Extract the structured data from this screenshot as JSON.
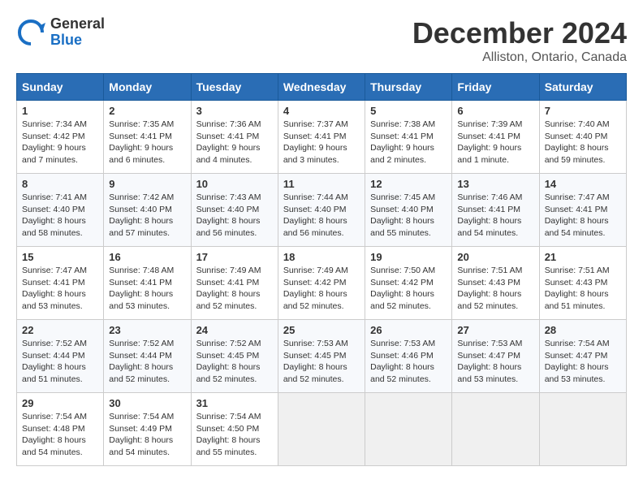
{
  "header": {
    "logo_general": "General",
    "logo_blue": "Blue",
    "month_title": "December 2024",
    "location": "Alliston, Ontario, Canada"
  },
  "days_of_week": [
    "Sunday",
    "Monday",
    "Tuesday",
    "Wednesday",
    "Thursday",
    "Friday",
    "Saturday"
  ],
  "weeks": [
    [
      {
        "day": "1",
        "sunrise": "7:34 AM",
        "sunset": "4:42 PM",
        "daylight": "9 hours and 7 minutes."
      },
      {
        "day": "2",
        "sunrise": "7:35 AM",
        "sunset": "4:41 PM",
        "daylight": "9 hours and 6 minutes."
      },
      {
        "day": "3",
        "sunrise": "7:36 AM",
        "sunset": "4:41 PM",
        "daylight": "9 hours and 4 minutes."
      },
      {
        "day": "4",
        "sunrise": "7:37 AM",
        "sunset": "4:41 PM",
        "daylight": "9 hours and 3 minutes."
      },
      {
        "day": "5",
        "sunrise": "7:38 AM",
        "sunset": "4:41 PM",
        "daylight": "9 hours and 2 minutes."
      },
      {
        "day": "6",
        "sunrise": "7:39 AM",
        "sunset": "4:41 PM",
        "daylight": "9 hours and 1 minute."
      },
      {
        "day": "7",
        "sunrise": "7:40 AM",
        "sunset": "4:40 PM",
        "daylight": "8 hours and 59 minutes."
      }
    ],
    [
      {
        "day": "8",
        "sunrise": "7:41 AM",
        "sunset": "4:40 PM",
        "daylight": "8 hours and 58 minutes."
      },
      {
        "day": "9",
        "sunrise": "7:42 AM",
        "sunset": "4:40 PM",
        "daylight": "8 hours and 57 minutes."
      },
      {
        "day": "10",
        "sunrise": "7:43 AM",
        "sunset": "4:40 PM",
        "daylight": "8 hours and 56 minutes."
      },
      {
        "day": "11",
        "sunrise": "7:44 AM",
        "sunset": "4:40 PM",
        "daylight": "8 hours and 56 minutes."
      },
      {
        "day": "12",
        "sunrise": "7:45 AM",
        "sunset": "4:40 PM",
        "daylight": "8 hours and 55 minutes."
      },
      {
        "day": "13",
        "sunrise": "7:46 AM",
        "sunset": "4:41 PM",
        "daylight": "8 hours and 54 minutes."
      },
      {
        "day": "14",
        "sunrise": "7:47 AM",
        "sunset": "4:41 PM",
        "daylight": "8 hours and 54 minutes."
      }
    ],
    [
      {
        "day": "15",
        "sunrise": "7:47 AM",
        "sunset": "4:41 PM",
        "daylight": "8 hours and 53 minutes."
      },
      {
        "day": "16",
        "sunrise": "7:48 AM",
        "sunset": "4:41 PM",
        "daylight": "8 hours and 53 minutes."
      },
      {
        "day": "17",
        "sunrise": "7:49 AM",
        "sunset": "4:41 PM",
        "daylight": "8 hours and 52 minutes."
      },
      {
        "day": "18",
        "sunrise": "7:49 AM",
        "sunset": "4:42 PM",
        "daylight": "8 hours and 52 minutes."
      },
      {
        "day": "19",
        "sunrise": "7:50 AM",
        "sunset": "4:42 PM",
        "daylight": "8 hours and 52 minutes."
      },
      {
        "day": "20",
        "sunrise": "7:51 AM",
        "sunset": "4:43 PM",
        "daylight": "8 hours and 52 minutes."
      },
      {
        "day": "21",
        "sunrise": "7:51 AM",
        "sunset": "4:43 PM",
        "daylight": "8 hours and 51 minutes."
      }
    ],
    [
      {
        "day": "22",
        "sunrise": "7:52 AM",
        "sunset": "4:44 PM",
        "daylight": "8 hours and 51 minutes."
      },
      {
        "day": "23",
        "sunrise": "7:52 AM",
        "sunset": "4:44 PM",
        "daylight": "8 hours and 52 minutes."
      },
      {
        "day": "24",
        "sunrise": "7:52 AM",
        "sunset": "4:45 PM",
        "daylight": "8 hours and 52 minutes."
      },
      {
        "day": "25",
        "sunrise": "7:53 AM",
        "sunset": "4:45 PM",
        "daylight": "8 hours and 52 minutes."
      },
      {
        "day": "26",
        "sunrise": "7:53 AM",
        "sunset": "4:46 PM",
        "daylight": "8 hours and 52 minutes."
      },
      {
        "day": "27",
        "sunrise": "7:53 AM",
        "sunset": "4:47 PM",
        "daylight": "8 hours and 53 minutes."
      },
      {
        "day": "28",
        "sunrise": "7:54 AM",
        "sunset": "4:47 PM",
        "daylight": "8 hours and 53 minutes."
      }
    ],
    [
      {
        "day": "29",
        "sunrise": "7:54 AM",
        "sunset": "4:48 PM",
        "daylight": "8 hours and 54 minutes."
      },
      {
        "day": "30",
        "sunrise": "7:54 AM",
        "sunset": "4:49 PM",
        "daylight": "8 hours and 54 minutes."
      },
      {
        "day": "31",
        "sunrise": "7:54 AM",
        "sunset": "4:50 PM",
        "daylight": "8 hours and 55 minutes."
      },
      null,
      null,
      null,
      null
    ]
  ]
}
